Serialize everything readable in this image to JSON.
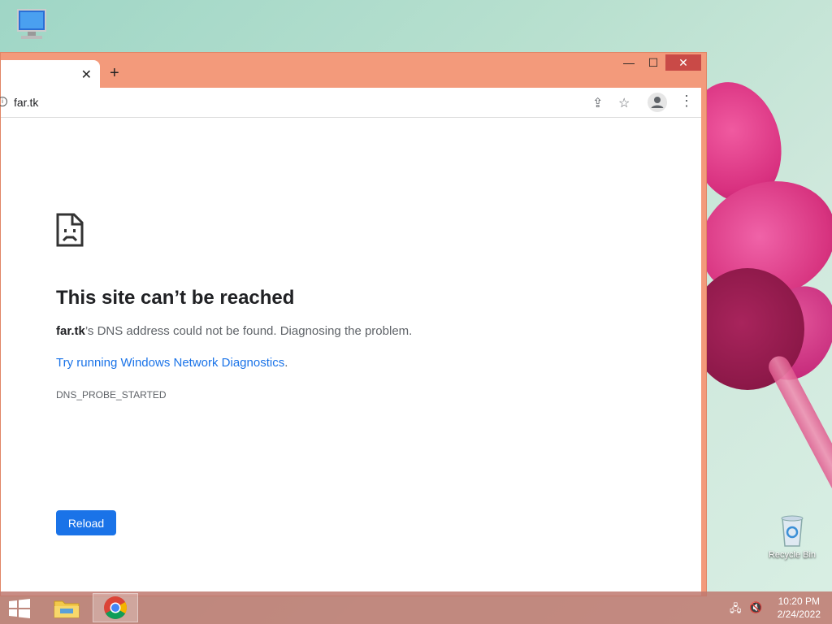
{
  "desktop": {
    "computer_label": "",
    "recycle_bin_label": "Recycle Bin"
  },
  "window": {
    "minimize_glyph": "—",
    "maximize_glyph": "☐",
    "close_glyph": "✕",
    "tab_close_glyph": "✕",
    "new_tab_glyph": "+"
  },
  "toolbar": {
    "address": "far.tk",
    "share_glyph": "⇪",
    "bookmark_glyph": "☆",
    "menu_glyph": "⋮"
  },
  "error_page": {
    "title": "This site can’t be reached",
    "host": "far.tk",
    "description_suffix": "’s DNS address could not be found. Diagnosing the problem.",
    "link_text": "Try running Windows Network Diagnostics",
    "link_period": ".",
    "error_code": "DNS_PROBE_STARTED",
    "reload_label": "Reload"
  },
  "taskbar": {
    "time": "10:20 PM",
    "date": "2/24/2022"
  },
  "colors": {
    "accent": "#1a73e8",
    "window_frame": "#f39a7b",
    "close_button": "#c94a47"
  }
}
